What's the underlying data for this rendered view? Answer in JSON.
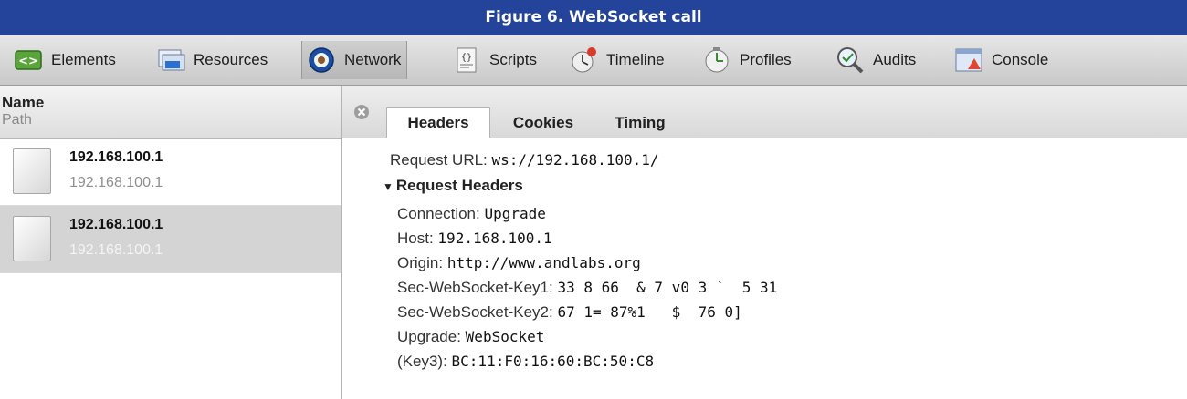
{
  "figure": {
    "caption": "Figure 6. WebSocket call"
  },
  "toolbar": {
    "items": [
      {
        "label": "Elements",
        "icon": "elements-icon"
      },
      {
        "label": "Resources",
        "icon": "resources-icon"
      },
      {
        "label": "Network",
        "icon": "network-icon",
        "active": true
      },
      {
        "label": "Scripts",
        "icon": "scripts-icon"
      },
      {
        "label": "Timeline",
        "icon": "timeline-icon"
      },
      {
        "label": "Profiles",
        "icon": "profiles-icon"
      },
      {
        "label": "Audits",
        "icon": "audits-icon"
      },
      {
        "label": "Console",
        "icon": "console-icon"
      }
    ]
  },
  "request_list": {
    "header": {
      "name": "Name",
      "path": "Path"
    },
    "rows": [
      {
        "name": "192.168.100.1",
        "path": "192.168.100.1",
        "selected": false
      },
      {
        "name": "192.168.100.1",
        "path": "192.168.100.1",
        "selected": true
      }
    ]
  },
  "detail": {
    "tabs": [
      "Headers",
      "Cookies",
      "Timing"
    ],
    "active_tab": "Headers",
    "request_url": {
      "label": "Request URL:",
      "value": "ws://192.168.100.1/"
    },
    "section_title": "Request Headers",
    "headers": [
      {
        "label": "Connection:",
        "value": "Upgrade"
      },
      {
        "label": "Host:",
        "value": "192.168.100.1"
      },
      {
        "label": "Origin:",
        "value": "http://www.andlabs.org"
      },
      {
        "label": "Sec-WebSocket-Key1:",
        "value": "33 8 66  & 7 v0 3 `  5 31"
      },
      {
        "label": "Sec-WebSocket-Key2:",
        "value": "67 1= 87%1   $  76 0]"
      },
      {
        "label": "Upgrade:",
        "value": "WebSocket"
      },
      {
        "label": "(Key3):",
        "value": "BC:11:F0:16:60:BC:50:C8"
      }
    ]
  },
  "colors": {
    "banner": "#23449a",
    "selected_row": "#d4d4d4"
  }
}
